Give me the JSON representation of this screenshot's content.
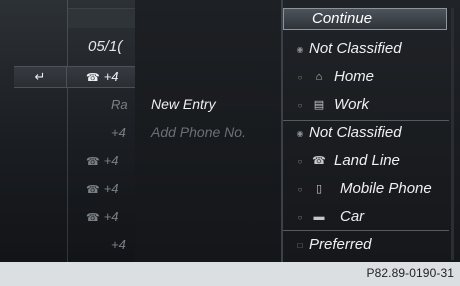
{
  "calls": {
    "date": "05/1(",
    "back_icon": "back-arrow-icon",
    "rows": [
      {
        "icon": "phone-icon",
        "text": "+4",
        "bright": true,
        "has_icon": true
      },
      {
        "icon": "",
        "text": "Ra",
        "bright": false,
        "has_icon": false
      },
      {
        "icon": "",
        "text": "+4",
        "bright": false,
        "has_icon": false
      },
      {
        "icon": "phone-icon",
        "text": "+4",
        "bright": false,
        "has_icon": true
      },
      {
        "icon": "phone-icon",
        "text": "+4",
        "bright": false,
        "has_icon": true
      },
      {
        "icon": "phone-icon",
        "text": "+4",
        "bright": false,
        "has_icon": true
      },
      {
        "icon": "",
        "text": "+4",
        "bright": false,
        "has_icon": false
      }
    ]
  },
  "submenu": {
    "new_entry": "New Entry",
    "add_phone": "Add Phone No."
  },
  "menu": {
    "continue": "Continue",
    "items": [
      {
        "label": "Not Classified",
        "marker": "radio-selected",
        "icon": ""
      },
      {
        "label": "Home",
        "marker": "radio",
        "icon": "home-icon"
      },
      {
        "label": "Work",
        "marker": "radio",
        "icon": "work-icon"
      },
      {
        "label": "Not Classified",
        "marker": "radio-selected",
        "icon": ""
      },
      {
        "label": "Land Line",
        "marker": "radio",
        "icon": "landline-icon"
      },
      {
        "label": "Mobile Phone",
        "marker": "radio",
        "icon": "mobile-phone-icon"
      },
      {
        "label": "Car",
        "marker": "radio",
        "icon": "car-icon"
      },
      {
        "label": "Preferred",
        "marker": "checkbox",
        "icon": ""
      }
    ]
  },
  "footer": {
    "code": "P82.89-0190-31"
  }
}
